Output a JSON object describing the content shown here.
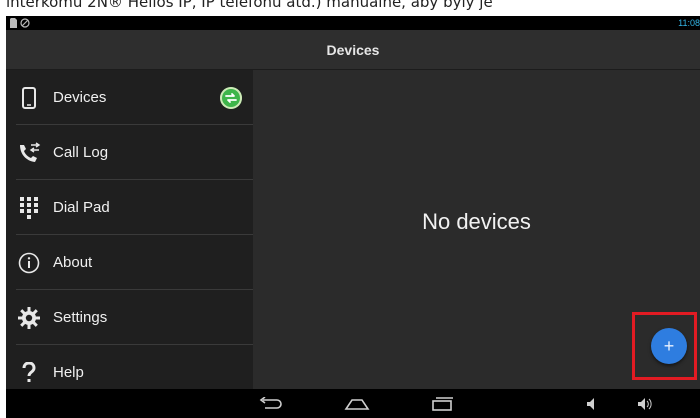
{
  "caption": "interkomu 2N® Helios IP, IP telefonu atd.) manuálně, aby byly je",
  "status_bar": {
    "time": "11:08",
    "icons": [
      "sd-card-icon",
      "no-signal-icon"
    ]
  },
  "action_bar": {
    "title": "Devices"
  },
  "drawer": {
    "items": [
      {
        "label": "Devices",
        "icon": "phone-icon",
        "badge": "sync-icon"
      },
      {
        "label": "Call Log",
        "icon": "call-log-icon"
      },
      {
        "label": "Dial Pad",
        "icon": "dialpad-icon"
      },
      {
        "label": "About",
        "icon": "info-icon"
      },
      {
        "label": "Settings",
        "icon": "gear-icon"
      },
      {
        "label": "Help",
        "icon": "question-icon"
      }
    ]
  },
  "content": {
    "empty_message": "No devices"
  },
  "fab": {
    "label": "+",
    "icon": "add-icon"
  },
  "colors": {
    "accent": "#2e7de0",
    "highlight": "#e21b23",
    "sync_badge": "#3eb54a",
    "status_text": "#33b5e5"
  },
  "system_nav": [
    "back-icon",
    "home-icon",
    "recents-icon",
    "volume-down-icon",
    "volume-up-icon"
  ]
}
